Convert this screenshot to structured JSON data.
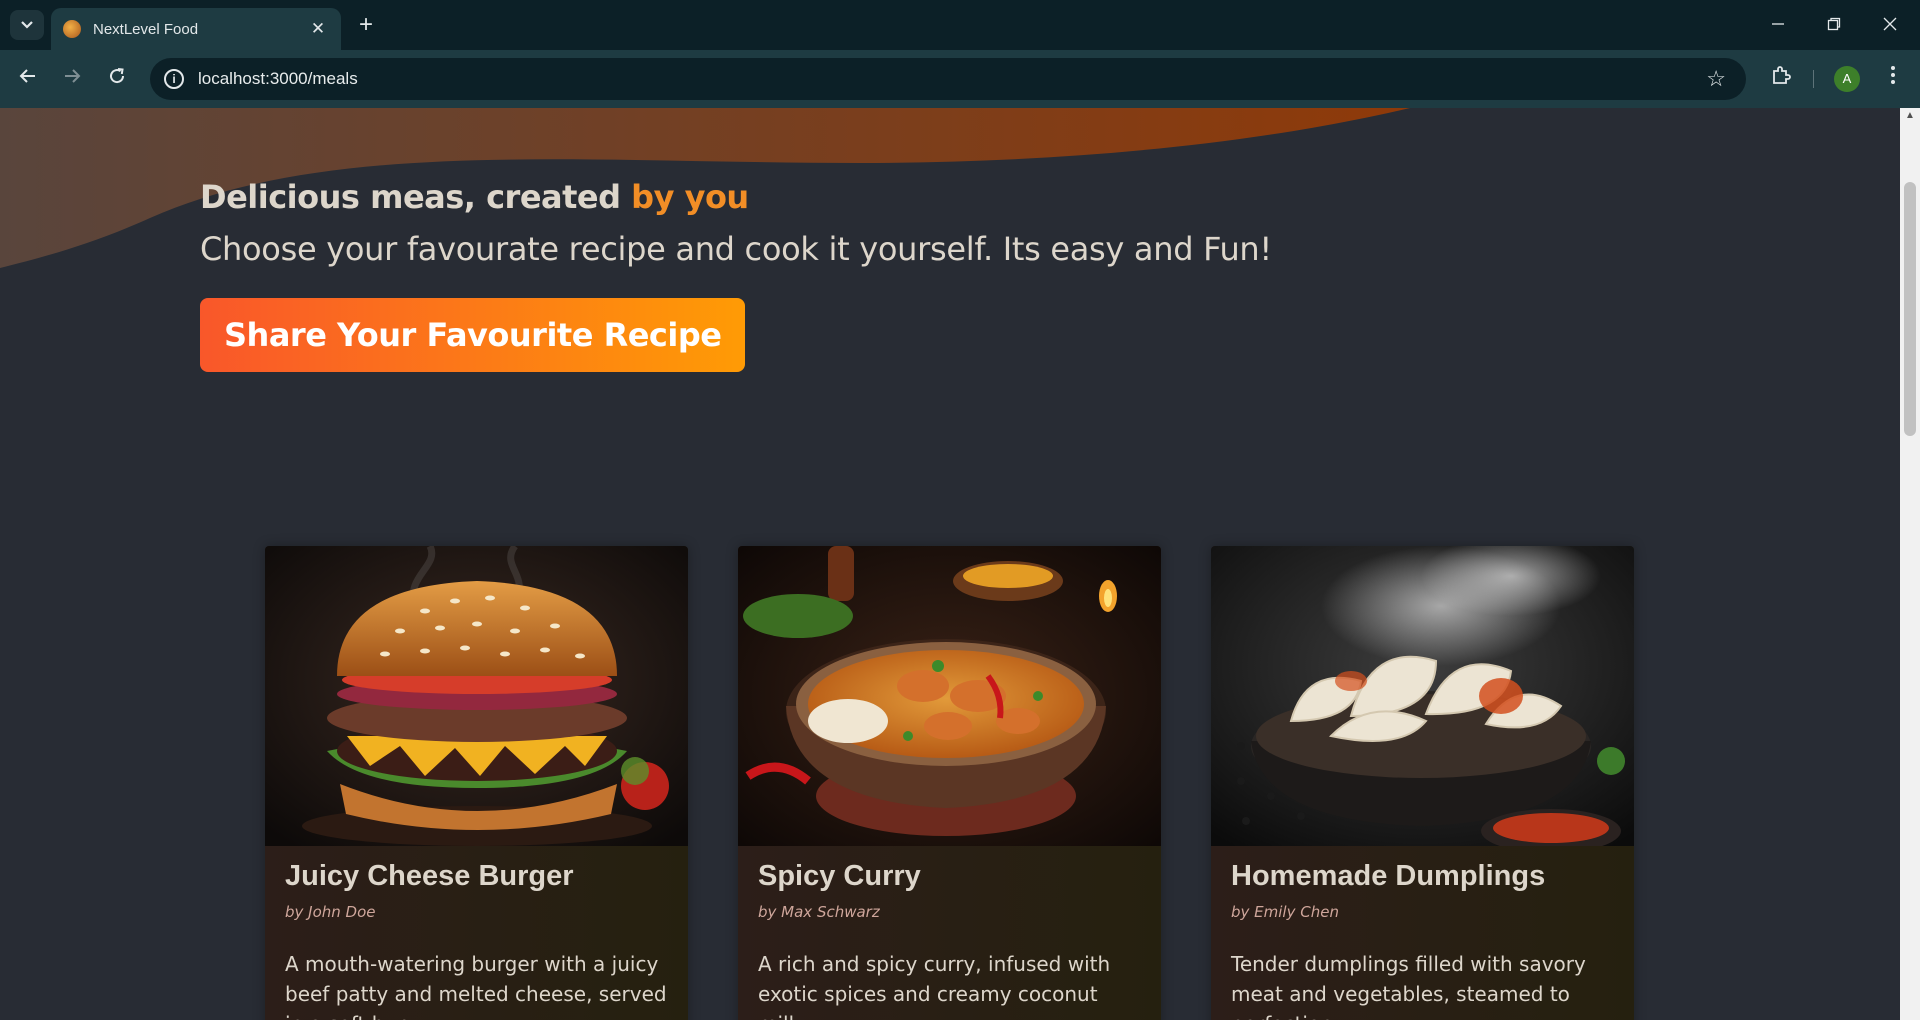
{
  "browser": {
    "tab_title": "NextLevel Food",
    "url": "localhost:3000/meals",
    "profile_initial": "A"
  },
  "hero": {
    "title_main": "Delicious meas, created ",
    "title_accent": "by you",
    "subtitle": "Choose your favourate recipe and cook it yourself. Its easy and Fun!",
    "cta_label": "Share Your Favourite Recipe"
  },
  "colors": {
    "accent": "#f28e26",
    "button_gradient_start": "#f9572a",
    "button_gradient_end": "#ff9b05",
    "page_background": "#282c34"
  },
  "meals": [
    {
      "title": "Juicy Cheese Burger",
      "author": "by John Doe",
      "summary": "A mouth-watering burger with a juicy beef patty and melted cheese, served in a soft bun.",
      "image_icon": "burger-image"
    },
    {
      "title": "Spicy Curry",
      "author": "by Max Schwarz",
      "summary": "A rich and spicy curry, infused with exotic spices and creamy coconut milk.",
      "image_icon": "curry-image"
    },
    {
      "title": "Homemade Dumplings",
      "author": "by Emily Chen",
      "summary": "Tender dumplings filled with savory meat and vegetables, steamed to perfection.",
      "image_icon": "dumplings-image"
    }
  ]
}
